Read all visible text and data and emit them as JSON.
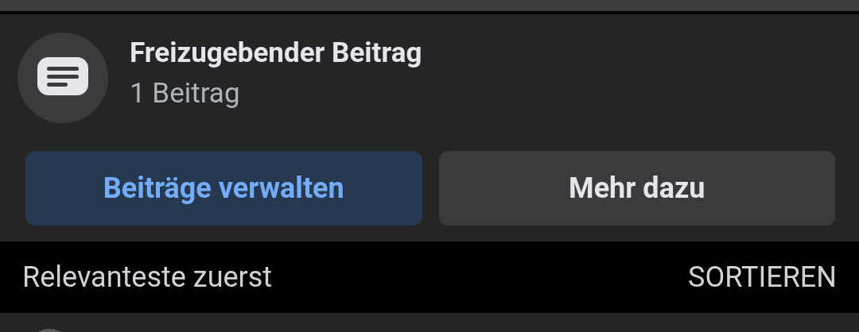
{
  "group": {
    "title": "Freizugebender Beitrag",
    "subtitle": "1 Beitrag"
  },
  "buttons": [
    {
      "label": "Beiträge verwalten",
      "kind": "primary"
    },
    {
      "label": "Mehr dazu",
      "kind": "secondary"
    }
  ],
  "sort": {
    "label": "Relevanteste zuerst",
    "action": "SORTIEREN"
  }
}
